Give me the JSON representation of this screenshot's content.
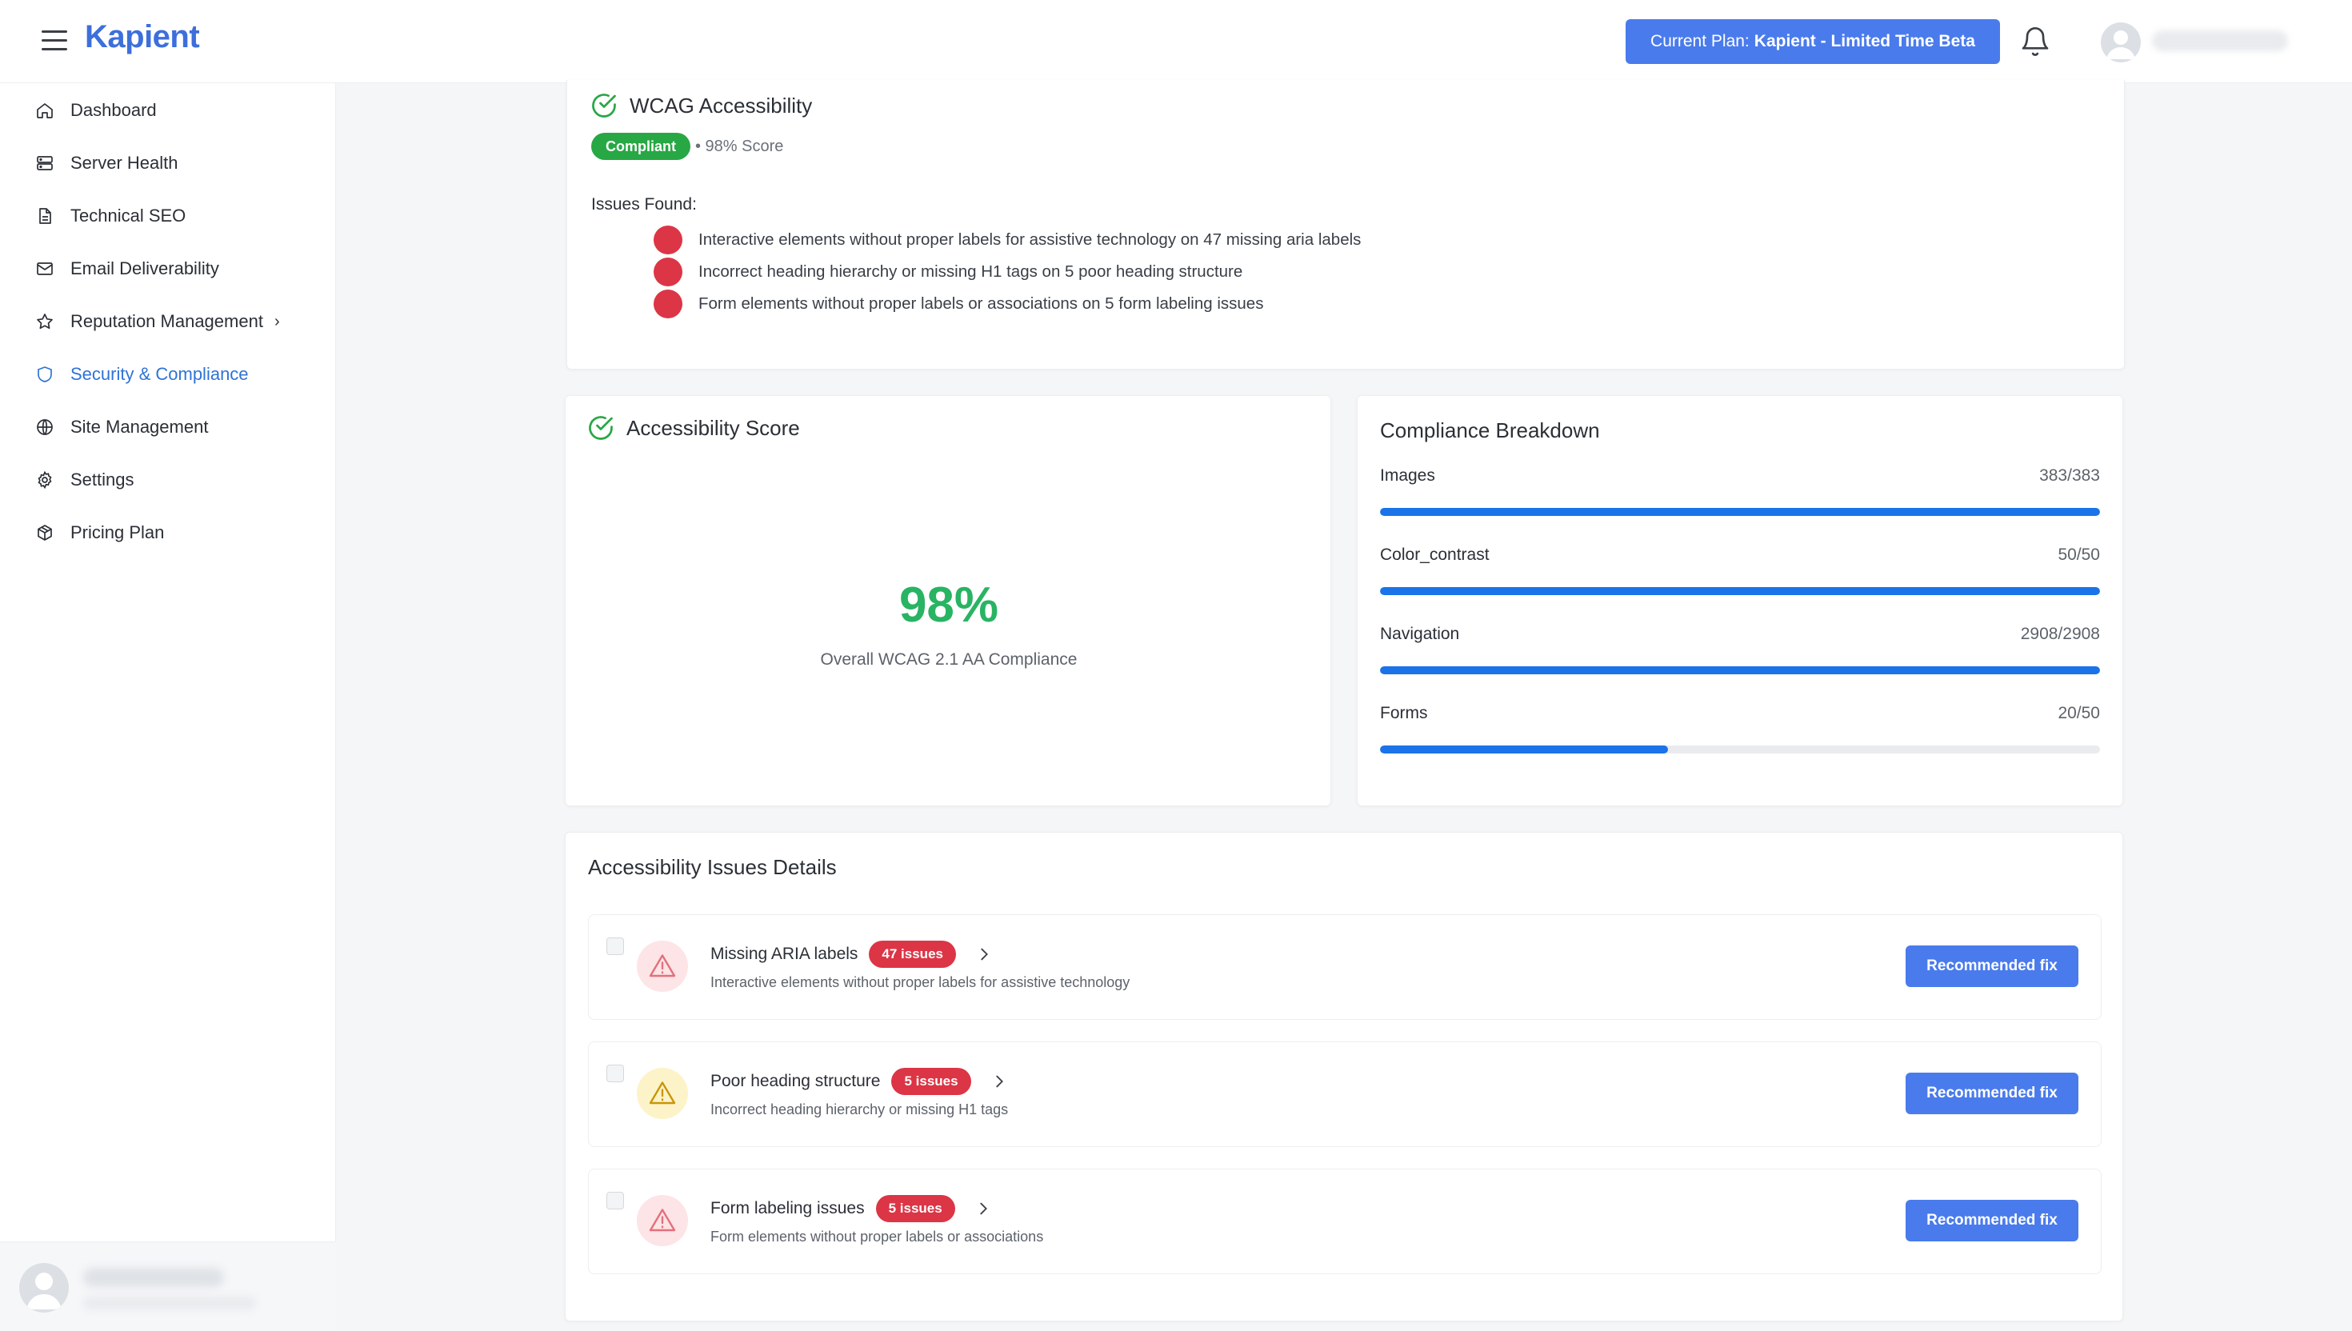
{
  "header": {
    "logo": "Kapient",
    "plan_prefix": "Current Plan:",
    "plan_name": "Kapient - Limited Time Beta"
  },
  "sidebar": {
    "items": [
      {
        "label": "Dashboard",
        "icon": "home-icon"
      },
      {
        "label": "Server Health",
        "icon": "server-icon"
      },
      {
        "label": "Technical SEO",
        "icon": "document-icon"
      },
      {
        "label": "Email Deliverability",
        "icon": "mail-icon"
      },
      {
        "label": "Reputation Management",
        "icon": "star-icon"
      },
      {
        "label": "Security & Compliance",
        "icon": "shield-icon",
        "active": true
      },
      {
        "label": "Site Management",
        "icon": "globe-icon"
      },
      {
        "label": "Settings",
        "icon": "gear-icon"
      },
      {
        "label": "Pricing Plan",
        "icon": "package-icon"
      }
    ]
  },
  "wcag": {
    "title": "WCAG Accessibility",
    "status": "Compliant",
    "score_text": "• 98% Score",
    "issues_label": "Issues Found:",
    "issues": [
      "Interactive elements without proper labels for assistive technology on 47 missing aria labels",
      "Incorrect heading hierarchy or missing H1 tags on 5 poor heading structure",
      "Form elements without proper labels or associations on 5 form labeling issues"
    ]
  },
  "score_card": {
    "title": "Accessibility Score",
    "score": "98%",
    "subtitle": "Overall WCAG 2.1 AA Compliance"
  },
  "breakdown": {
    "title": "Compliance Breakdown",
    "rows": [
      {
        "label": "Images",
        "value": "383/383",
        "fraction": 1.0
      },
      {
        "label": "Color_contrast",
        "value": "50/50",
        "fraction": 1.0
      },
      {
        "label": "Navigation",
        "value": "2908/2908",
        "fraction": 1.0
      },
      {
        "label": "Forms",
        "value": "20/50",
        "fraction": 0.4
      }
    ],
    "bar_color": "#1a73e8"
  },
  "details": {
    "title": "Accessibility Issues Details",
    "fix_label": "Recommended fix",
    "rows": [
      {
        "title": "Missing ARIA labels",
        "badge": "47 issues",
        "desc": "Interactive elements without proper labels for assistive technology",
        "severity": "error"
      },
      {
        "title": "Poor heading structure",
        "badge": "5 issues",
        "desc": "Incorrect heading hierarchy or missing H1 tags",
        "severity": "warning"
      },
      {
        "title": "Form labeling issues",
        "badge": "5 issues",
        "desc": "Form elements without proper labels or associations",
        "severity": "error"
      }
    ]
  },
  "colors": {
    "accent": "#4a7bec",
    "success": "#28a745",
    "danger": "#dc3545",
    "warning": "#e0a800"
  }
}
